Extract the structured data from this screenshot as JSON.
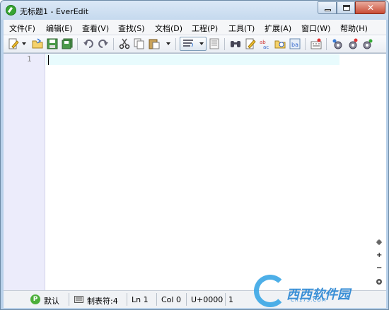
{
  "window": {
    "title": "无标题1 - EverEdit",
    "close_glyph": "✕"
  },
  "menu": [
    "文件(F)",
    "编辑(E)",
    "查看(V)",
    "查找(S)",
    "文档(D)",
    "工程(P)",
    "工具(T)",
    "扩展(A)",
    "窗口(W)",
    "帮助(H)"
  ],
  "toolbar": {
    "icons": [
      "new-file-icon",
      "open-folder-icon",
      "save-icon",
      "save-all-icon",
      "undo-icon",
      "redo-icon",
      "cut-icon",
      "copy-icon",
      "paste-icon",
      "word-wrap-icon",
      "column-mode-icon",
      "find-icon",
      "find-in-files-icon",
      "replace-icon",
      "find-in-folder-icon",
      "goto-icon",
      "record-macro-icon",
      "settings-icon",
      "plugin-icon",
      "options-icon"
    ]
  },
  "editor": {
    "line_numbers": [
      "1"
    ]
  },
  "zoom": {
    "zoom_in": "+",
    "zoom_out": "−"
  },
  "statusbar": {
    "encoding": "默认",
    "tab": "制表符:4",
    "line": "Ln 1",
    "col": "Col 0",
    "unicode": "U+0000",
    "count": "1"
  },
  "watermark": {
    "text": "西西软件园",
    "domain": "CR173.COM"
  },
  "colors": {
    "gutter": "#ececfb",
    "current_line": "#e8fbfd",
    "titlebar": "#c5d9ee",
    "close_button": "#c94c35"
  }
}
